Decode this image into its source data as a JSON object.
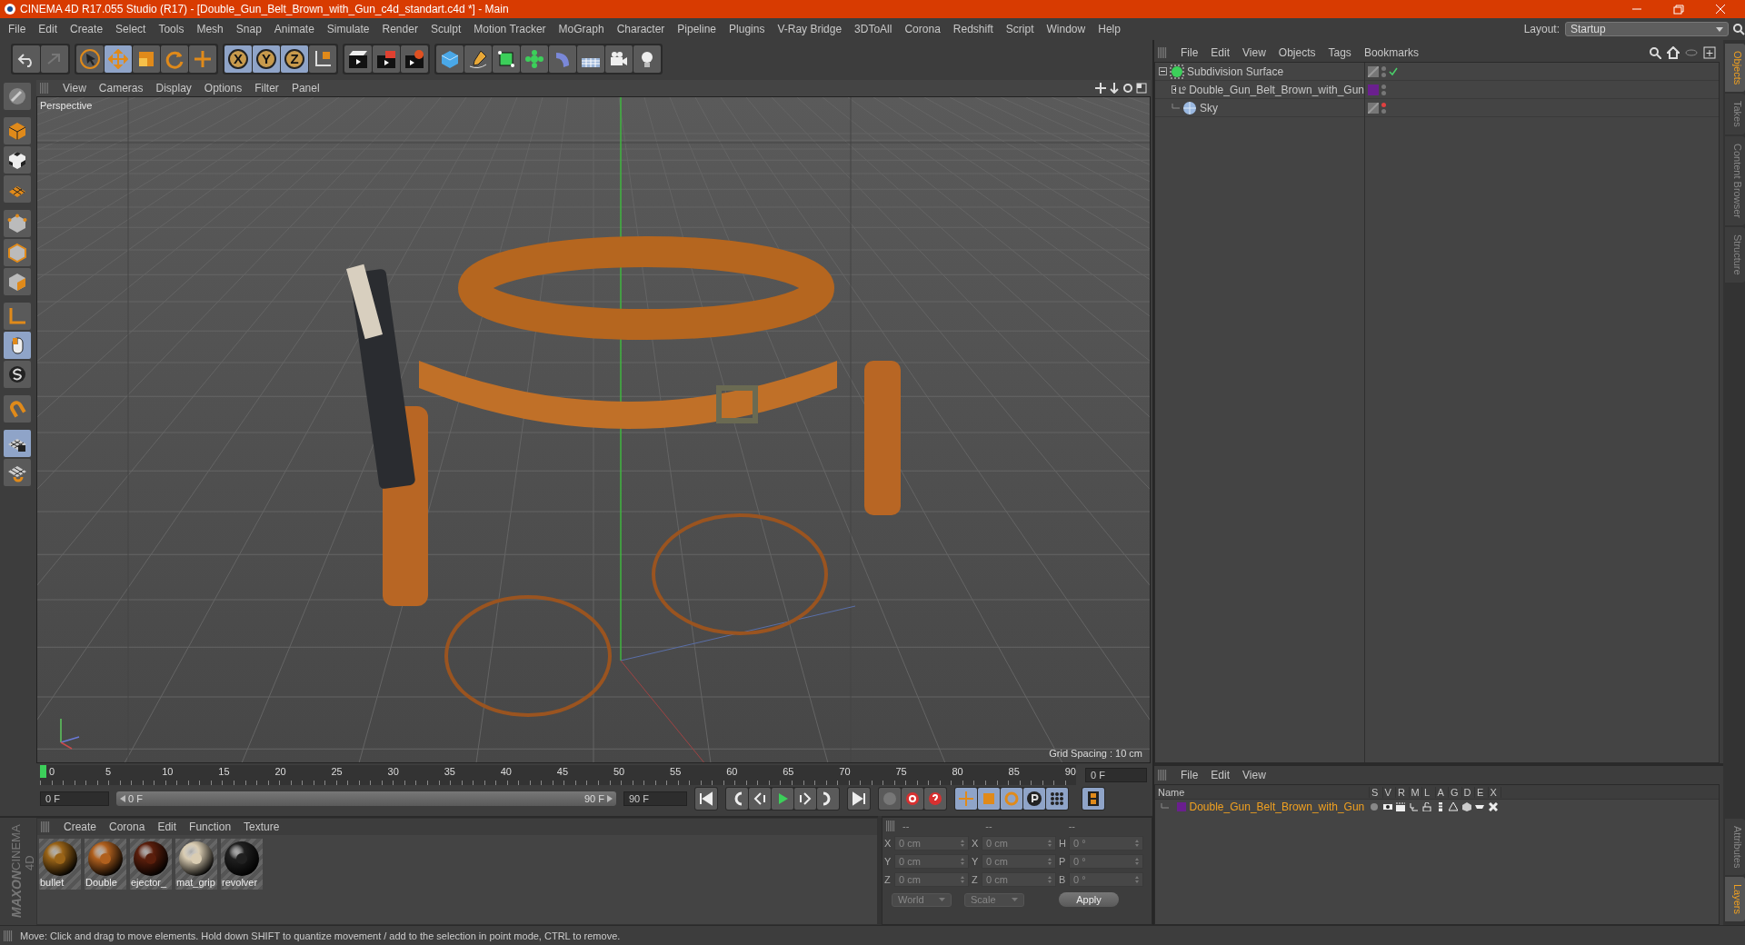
{
  "window": {
    "title": "CINEMA 4D R17.055 Studio (R17) - [Double_Gun_Belt_Brown_with_Gun_c4d_standart.c4d *] - Main"
  },
  "menu": [
    "File",
    "Edit",
    "Create",
    "Select",
    "Tools",
    "Mesh",
    "Snap",
    "Animate",
    "Simulate",
    "Render",
    "Sculpt",
    "Motion Tracker",
    "MoGraph",
    "Character",
    "Pipeline",
    "Plugins",
    "V-Ray Bridge",
    "3DToAll",
    "Corona",
    "Redshift",
    "Script",
    "Window",
    "Help"
  ],
  "layout": {
    "label": "Layout:",
    "value": "Startup"
  },
  "axis_toggles": [
    {
      "label": "X",
      "on": true
    },
    {
      "label": "Y",
      "on": true
    },
    {
      "label": "Z",
      "on": true
    }
  ],
  "viewport": {
    "menu": [
      "View",
      "Cameras",
      "Display",
      "Options",
      "Filter",
      "Panel"
    ],
    "camera": "Perspective",
    "grid_spacing": "Grid Spacing : 10 cm"
  },
  "timeline": {
    "ticks": [
      "0",
      "5",
      "10",
      "15",
      "20",
      "25",
      "30",
      "35",
      "40",
      "45",
      "50",
      "55",
      "60",
      "65",
      "70",
      "75",
      "80",
      "85",
      "90"
    ],
    "current_frame": "0 F",
    "start_field": "0 F",
    "range": {
      "start": "0 F",
      "end": "90 F",
      "level": 1
    },
    "end_field": "90 F"
  },
  "materials": {
    "menu": [
      "Create",
      "Corona",
      "Edit",
      "Function",
      "Texture"
    ],
    "items": [
      {
        "name": "bullet",
        "color": "#9a6418"
      },
      {
        "name": "Double",
        "color": "#b0601e"
      },
      {
        "name": "ejector_",
        "color": "#5a1e0c"
      },
      {
        "name": "mat_grip",
        "color": "#d9ccb2"
      },
      {
        "name": "revolver",
        "color": "#202020"
      }
    ]
  },
  "brand": {
    "line1": "MAXON",
    "line2": "CINEMA 4D"
  },
  "coordinates": {
    "headers": [
      "--",
      "--",
      "--"
    ],
    "rows": [
      {
        "pos_axis": "X",
        "pos": "0 cm",
        "size_axis": "X",
        "size": "0 cm",
        "rot_axis": "H",
        "rot": "0 °"
      },
      {
        "pos_axis": "Y",
        "pos": "0 cm",
        "size_axis": "Y",
        "size": "0 cm",
        "rot_axis": "P",
        "rot": "0 °"
      },
      {
        "pos_axis": "Z",
        "pos": "0 cm",
        "size_axis": "Z",
        "size": "0 cm",
        "rot_axis": "B",
        "rot": "0 °"
      }
    ],
    "space": "World",
    "mode": "Scale",
    "apply": "Apply"
  },
  "objects": {
    "menu": [
      "File",
      "Edit",
      "View",
      "Objects",
      "Tags",
      "Bookmarks"
    ],
    "tree": [
      {
        "name": "Subdivision Surface",
        "kind": "subdivision",
        "expanded": true,
        "checked": true,
        "editor_hidden": false,
        "children": [
          {
            "name": "Double_Gun_Belt_Brown_with_Gun",
            "kind": "null",
            "expanded": false,
            "checked": false,
            "editor_hidden": false,
            "color": "#6a1f8e"
          },
          {
            "name": "Sky",
            "kind": "sky",
            "checked": false,
            "editor_hidden": true
          }
        ]
      }
    ]
  },
  "layers": {
    "menu": [
      "File",
      "Edit",
      "View"
    ],
    "columns": [
      "Name",
      "S",
      "V",
      "R",
      "M",
      "L",
      "A",
      "G",
      "D",
      "E",
      "X"
    ],
    "rows": [
      {
        "name": "Double_Gun_Belt_Brown_with_Gun",
        "color": "#6a1f8e"
      }
    ]
  },
  "side_tabs": {
    "top": [
      {
        "label": "Objects",
        "selected": true
      },
      {
        "label": "Takes",
        "selected": false
      },
      {
        "label": "Content Browser",
        "selected": false
      },
      {
        "label": "Structure",
        "selected": false
      }
    ],
    "bottom": [
      {
        "label": "Attributes",
        "selected": false
      },
      {
        "label": "Layers",
        "selected": true
      }
    ]
  },
  "status": "Move: Click and drag to move elements. Hold down SHIFT to quantize movement / add to the selection in point mode, CTRL to remove."
}
